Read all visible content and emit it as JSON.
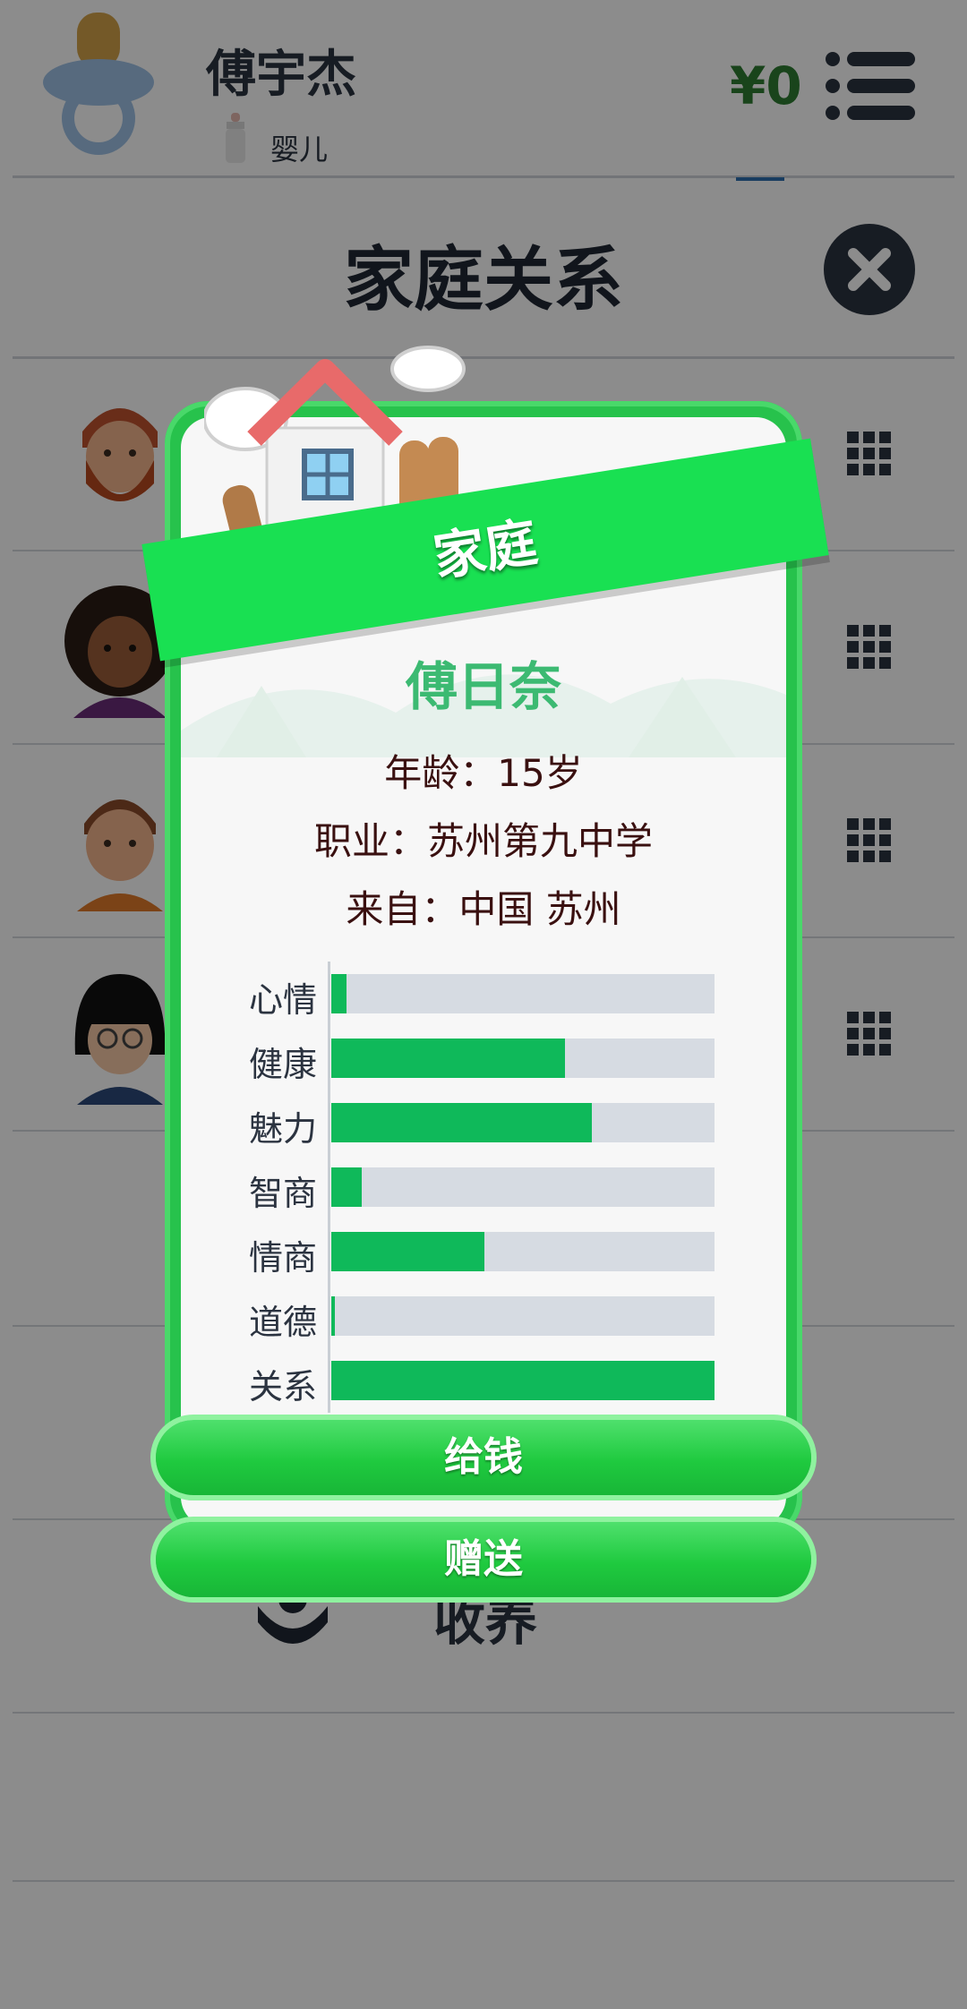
{
  "header": {
    "player_name": "傅宇杰",
    "life_stage": "婴儿",
    "money": "¥0"
  },
  "section": {
    "title": "家庭关系"
  },
  "family_list": {
    "adopt_label": "收养"
  },
  "modal": {
    "ribbon_label": "家庭",
    "name": "傅日奈",
    "age_line": "年龄：15岁",
    "job_line": "职业：苏州第九中学",
    "origin_line": "来自：中国 苏州",
    "stats": [
      {
        "label": "心情",
        "value": 0.04
      },
      {
        "label": "健康",
        "value": 0.61
      },
      {
        "label": "魅力",
        "value": 0.68
      },
      {
        "label": "智商",
        "value": 0.08
      },
      {
        "label": "情商",
        "value": 0.4
      },
      {
        "label": "道德",
        "value": 0.01
      },
      {
        "label": "关系",
        "value": 1.0
      }
    ],
    "buttons": {
      "give_money": "给钱",
      "gift": "赠送"
    }
  },
  "colors": {
    "accent_green": "#19e052",
    "stat_fill": "#0fb95a",
    "stat_track": "#d6dbe2",
    "money_green": "#2e7d32",
    "npc_name_green": "#3cba72"
  },
  "icons": [
    "pacifier-icon",
    "baby-bottle-icon",
    "menu-icon",
    "close-icon",
    "grid-icon",
    "house-icon",
    "adopt-hands-icon"
  ]
}
